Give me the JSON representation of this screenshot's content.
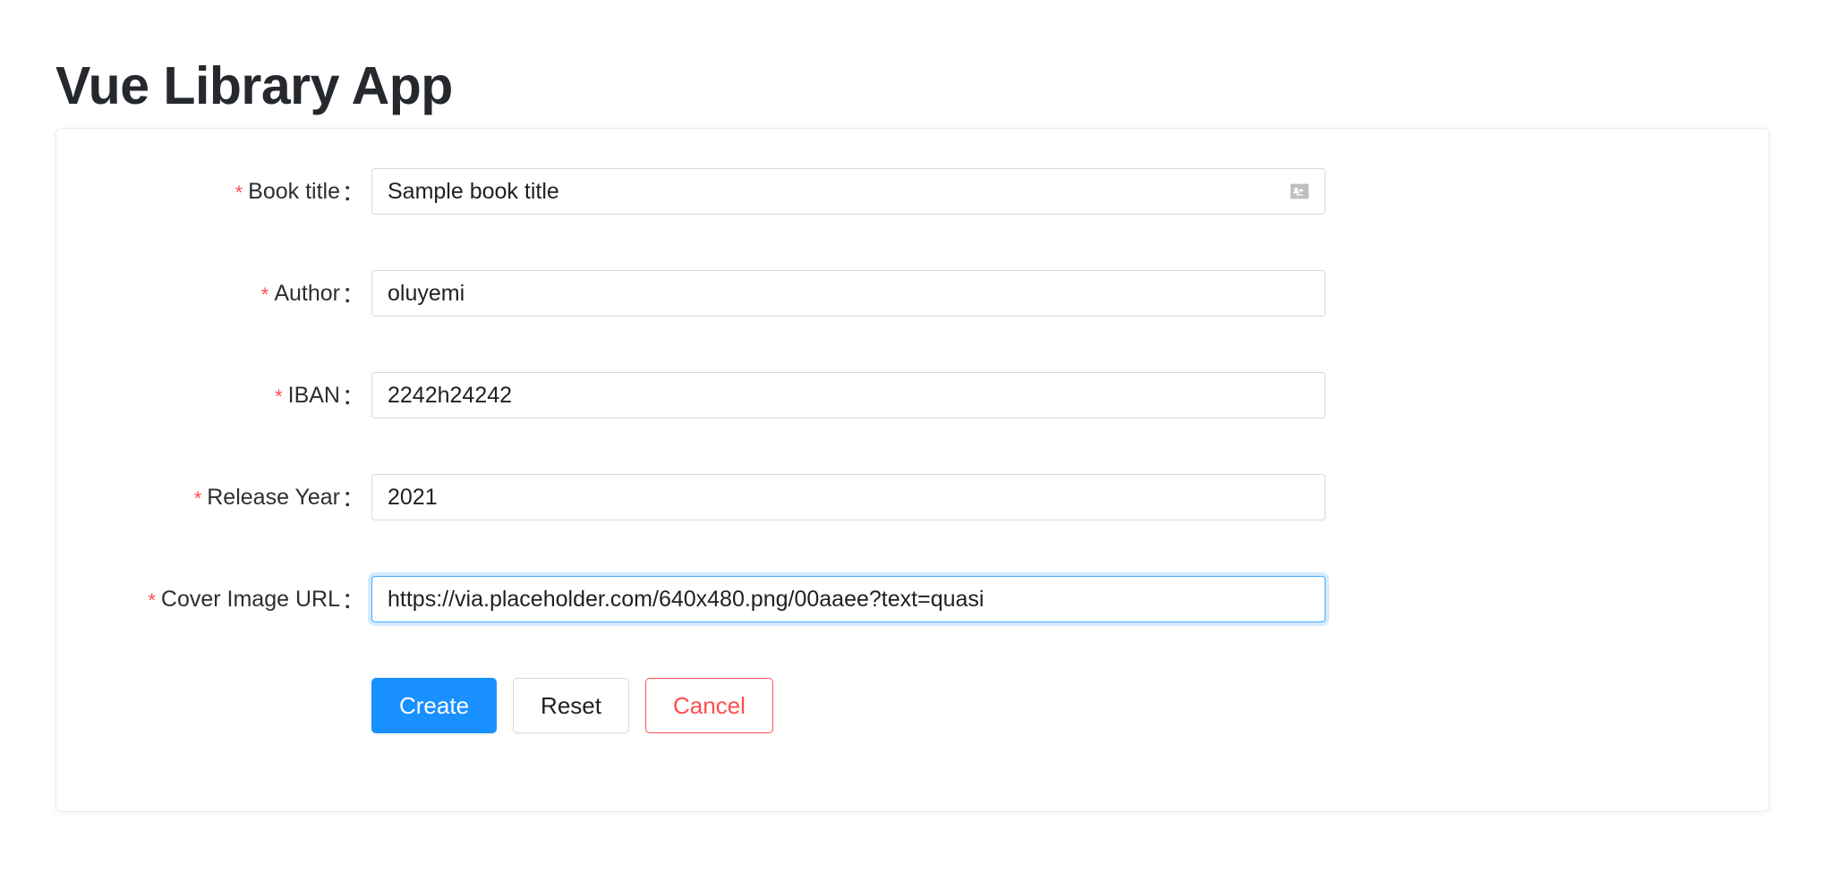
{
  "app": {
    "title": "Vue Library App"
  },
  "form": {
    "required_marker": "*",
    "colon": "：",
    "fields": [
      {
        "label": "Book title",
        "value": "Sample book title",
        "placeholder": "Book title",
        "required": true,
        "suffix_icon": "idcard-icon",
        "focused": false
      },
      {
        "label": "Author",
        "value": "oluyemi",
        "placeholder": "Author",
        "required": true,
        "suffix_icon": "",
        "focused": false
      },
      {
        "label": "IBAN",
        "value": "2242h24242",
        "placeholder": "IBAN",
        "required": true,
        "suffix_icon": "",
        "focused": false
      },
      {
        "label": "Release Year",
        "value": "2021",
        "placeholder": "Release Year",
        "required": true,
        "suffix_icon": "",
        "focused": false
      },
      {
        "label": "Cover Image URL",
        "value": "https://via.placeholder.com/640x480.png/00aaee?text=quasi",
        "placeholder": "Cover Image URL",
        "required": true,
        "suffix_icon": "",
        "focused": true
      }
    ],
    "buttons": {
      "submit": "Create",
      "reset": "Reset",
      "cancel": "Cancel"
    }
  },
  "colors": {
    "primary": "#1890ff",
    "danger": "#ff4d4f",
    "focus_border": "#40a9ff",
    "border": "#d9d9d9",
    "text": "#1d2125",
    "icon_gray": "#bfbfbf",
    "card_border": "#ebebeb"
  }
}
